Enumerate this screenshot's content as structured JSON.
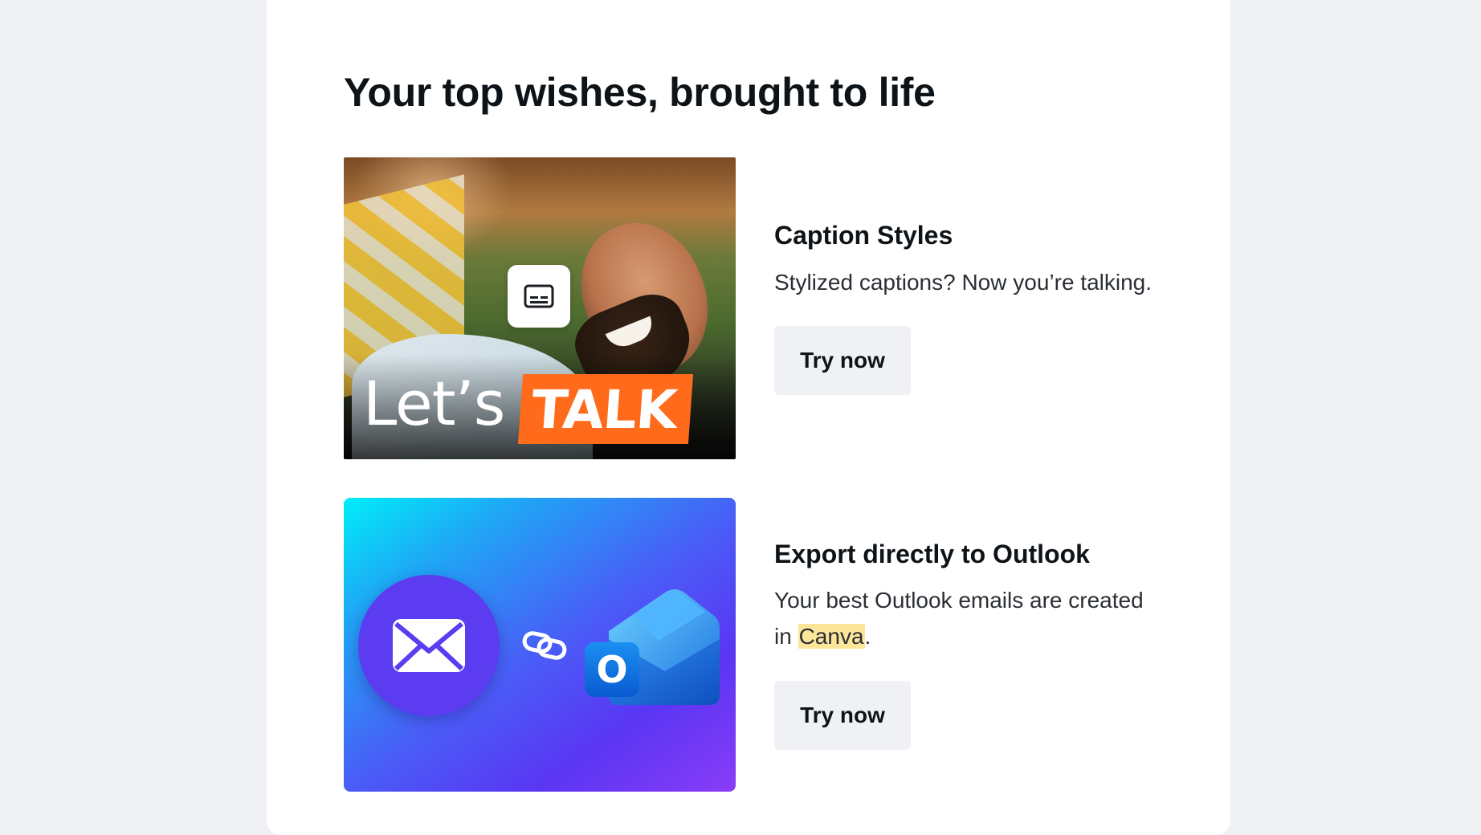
{
  "heading": "Your top wishes, brought to life",
  "features": [
    {
      "title": "Caption Styles",
      "description": "Stylized captions? Now you’re talking.",
      "button_label": "Try now",
      "image": {
        "overlay_text_1": "Let’s",
        "overlay_text_2": "TALK",
        "badge_icon": "subtitles-icon"
      }
    },
    {
      "title": "Export directly to Outlook",
      "description_prefix": "Your best Outlook emails are created in ",
      "description_highlight": "Canva",
      "description_suffix": ".",
      "button_label": "Try now",
      "image": {
        "left_icon": "envelope-icon",
        "middle_icon": "link-icon",
        "right_icon": "outlook-icon",
        "outlook_letter": "O"
      }
    }
  ],
  "colors": {
    "page_background": "#eef0f3",
    "card_background": "#ffffff",
    "button_background": "#f0f1f5",
    "highlight": "#fde59a",
    "talk_orange": "#ff6b1a"
  }
}
